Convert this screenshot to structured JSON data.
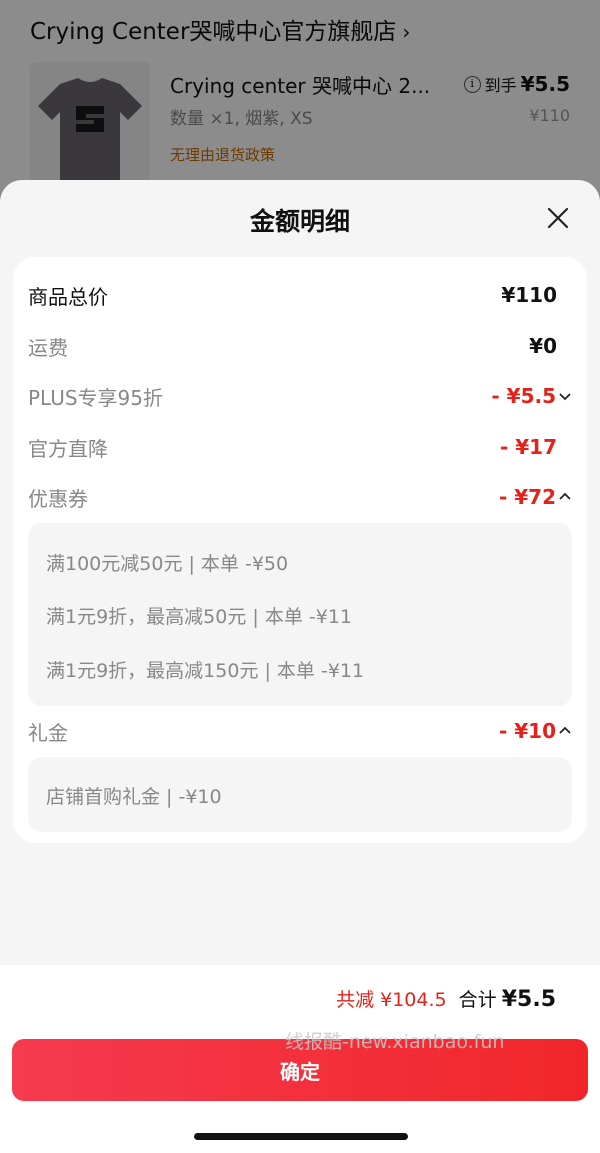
{
  "background": {
    "store_title": "Crying Center哭喊中心官方旗舰店",
    "store_chevron": "›",
    "product": {
      "name": "Crying center 哭喊中心  2...",
      "spec": "数量 ×1, 烟紫, XS",
      "policy": "无理由退货政策",
      "final_label": "到手",
      "final_price": "¥5.5",
      "original_price": "¥110",
      "info_icon": "i"
    }
  },
  "sheet": {
    "title": "金额明细",
    "rows": {
      "subtotal": {
        "label": "商品总价",
        "value": "¥110"
      },
      "shipping": {
        "label": "运费",
        "value": "¥0"
      },
      "plus": {
        "label": "PLUS专享95折",
        "value": "- ¥5.5"
      },
      "official": {
        "label": "官方直降",
        "value": "- ¥17"
      },
      "coupon": {
        "label": "优惠券",
        "value": "- ¥72"
      },
      "gift": {
        "label": "礼金",
        "value": "- ¥10"
      }
    },
    "coupon_items": [
      "满100元减50元 | 本单 -¥50",
      "满1元9折，最高减50元 | 本单 -¥11",
      "满1元9折，最高减150元 | 本单 -¥11"
    ],
    "gift_items": [
      "店铺首购礼金 | -¥10"
    ]
  },
  "footer": {
    "total_reduce": "共减 ¥104.5",
    "total_label": "合计",
    "total_amount": "¥5.5",
    "confirm": "确定",
    "watermark": "线报酷-new.xianbao.fun"
  },
  "colors": {
    "accent_red": "#e5221a",
    "button_gradient_start": "#f53b4f",
    "button_gradient_end": "#f1262a",
    "policy_orange": "#c46c00"
  },
  "icons": {
    "close": "close-icon",
    "caret_down": "chevron-down-icon",
    "caret_up": "chevron-up-icon",
    "info": "info-icon"
  }
}
